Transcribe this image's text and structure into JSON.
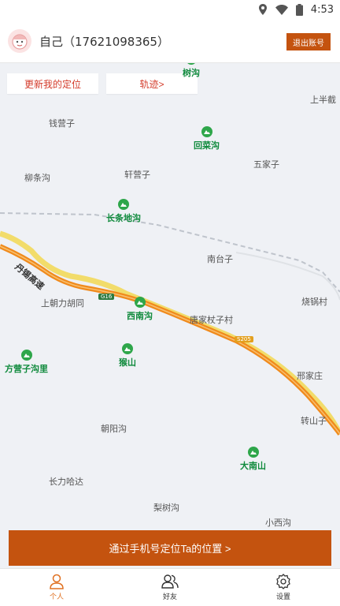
{
  "status_bar": {
    "time": "4:53"
  },
  "header": {
    "title": "自己（17621098365）",
    "logout_label": "退出账号"
  },
  "map": {
    "update_location_label": "更新我的定位",
    "track_label": "轨迹>",
    "places": [
      "钱营子",
      "上半截",
      "柳条沟",
      "轩营子",
      "五家子",
      "南台子",
      "上朝力胡同",
      "唐家杖子村",
      "烧锅村",
      "邢家庄",
      "朝阳沟",
      "转山子",
      "长力哈达",
      "梨树沟",
      "小西沟"
    ],
    "pois": [
      "树沟",
      "回菜沟",
      "长条地沟",
      "西南沟",
      "猴山",
      "方营子沟里",
      "大南山"
    ],
    "roads": {
      "expressway": "丹锡高速",
      "shield_g": "G16",
      "shield_s": "S205"
    }
  },
  "locate_button_label": "通过手机号定位Ta的位置 >",
  "nav": {
    "items": [
      {
        "label": "个人",
        "icon": "person-icon"
      },
      {
        "label": "好友",
        "icon": "friends-icon"
      },
      {
        "label": "设置",
        "icon": "gear-icon"
      }
    ]
  },
  "colors": {
    "accent": "#c4530f",
    "active_tab": "#e07020",
    "marker": "#e0261b",
    "poi": "#2ea64a"
  }
}
